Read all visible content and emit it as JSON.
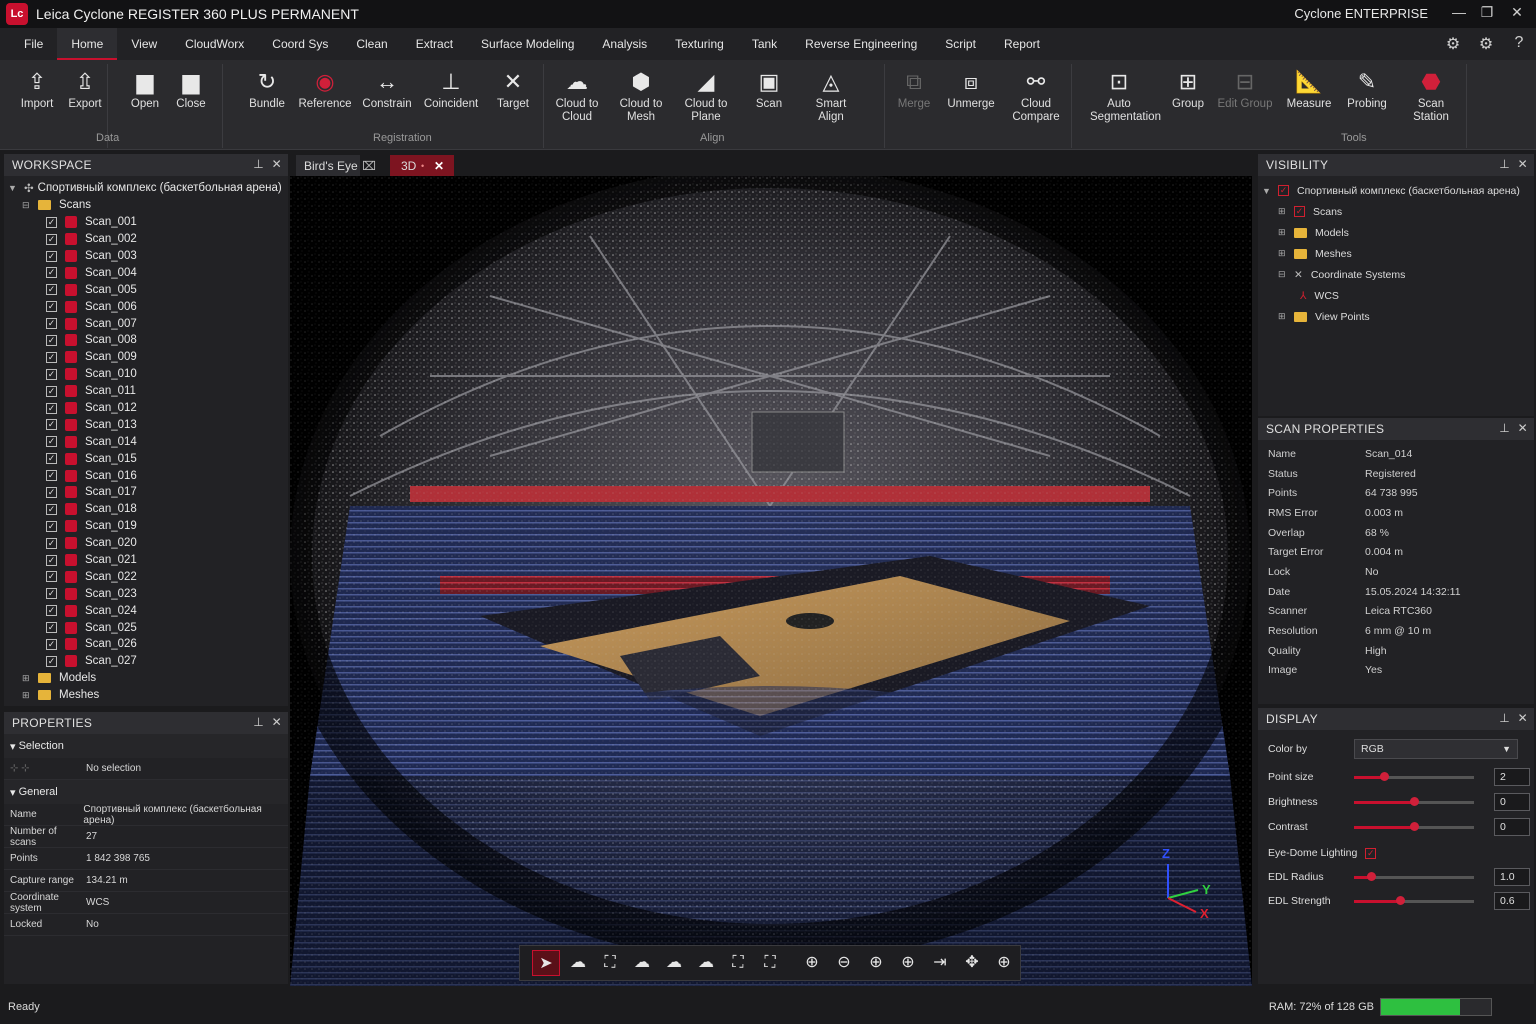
{
  "titlebar": {
    "logo": "Lc",
    "title": "Leica Cyclone REGISTER 360 PLUS PERMANENT",
    "edition": "Cyclone ENTERPRISE",
    "minimize_icon": "minimize-icon",
    "restore_icon": "restore-icon",
    "close_icon": "close-icon"
  },
  "menu": {
    "items": [
      "File",
      "Home",
      "View",
      "CloudWorx",
      "Coord Sys",
      "Clean",
      "Extract",
      "Surface Modeling",
      "Analysis",
      "Texturing",
      "Tank",
      "Reverse Engineering",
      "Script",
      "Report"
    ],
    "active": "Home"
  },
  "ribbon": {
    "buttons": [
      {
        "label": "Import",
        "icon": "import-icon",
        "glyph": "⇪"
      },
      {
        "label": "Export",
        "icon": "export-icon",
        "glyph": "⇫"
      },
      {
        "label": "Open",
        "icon": "folder-open-icon",
        "glyph": "▆"
      },
      {
        "label": "Close",
        "icon": "folder-close-icon",
        "glyph": "▆"
      },
      {
        "label": "Bundle",
        "icon": "bundle-icon",
        "glyph": "↻"
      },
      {
        "label": "Reference",
        "icon": "reference-icon",
        "glyph": "◉"
      },
      {
        "label": "Constrain",
        "icon": "constrain-icon",
        "glyph": "↔"
      },
      {
        "label": "Coincident",
        "icon": "coincident-icon",
        "glyph": "⊥"
      },
      {
        "label": "Target",
        "icon": "target-icon",
        "glyph": "✕"
      },
      {
        "label": "Cloud to Cloud",
        "icon": "cloud-to-cloud-icon",
        "glyph": "☁"
      },
      {
        "label": "Cloud to Mesh",
        "icon": "cloud-to-mesh-icon",
        "glyph": "⬢"
      },
      {
        "label": "Cloud to Plane",
        "icon": "cloud-to-plane-icon",
        "glyph": "◢"
      },
      {
        "label": "Scan",
        "icon": "scan-icon",
        "glyph": "▣"
      },
      {
        "label": "Smart Align",
        "icon": "smart-align-icon",
        "glyph": "◬"
      },
      {
        "label": "Merge",
        "icon": "merge-icon",
        "glyph": "⧉"
      },
      {
        "label": "Unmerge",
        "icon": "unmerge-icon",
        "glyph": "⧈"
      },
      {
        "label": "Cloud Compare",
        "icon": "cloud-compare-icon",
        "glyph": "⚯"
      },
      {
        "label": "Auto Segmentation",
        "icon": "auto-segmentation-icon",
        "glyph": "⊡"
      },
      {
        "label": "Group",
        "icon": "group-icon",
        "glyph": "⊞"
      },
      {
        "label": "Edit Group",
        "icon": "edit-group-icon",
        "glyph": "⊟"
      },
      {
        "label": "Measure",
        "icon": "measure-icon",
        "glyph": "📐"
      },
      {
        "label": "Probing",
        "icon": "probing-icon",
        "glyph": "✎"
      },
      {
        "label": "Scan Station",
        "icon": "scan-station-icon",
        "glyph": "⬣"
      }
    ],
    "groups": [
      "Data",
      "Registration",
      "Align",
      "Tools"
    ]
  },
  "workspace": {
    "title": "WORKSPACE",
    "pin_icon": "pin-icon",
    "close_icon": "close-icon",
    "project": "Спортивный комплекс (баскетбольная арена)",
    "scans_folder": "Scans",
    "scans": [
      "Scan_001",
      "Scan_002",
      "Scan_003",
      "Scan_004",
      "Scan_005",
      "Scan_006",
      "Scan_007",
      "Scan_008",
      "Scan_009",
      "Scan_010",
      "Scan_011",
      "Scan_012",
      "Scan_013",
      "Scan_014",
      "Scan_015",
      "Scan_016",
      "Scan_017",
      "Scan_018",
      "Scan_019",
      "Scan_020",
      "Scan_021",
      "Scan_022",
      "Scan_023",
      "Scan_024",
      "Scan_025",
      "Scan_026",
      "Scan_027"
    ],
    "models_folder": "Models",
    "meshes_folder": "Meshes"
  },
  "properties": {
    "title": "PROPERTIES",
    "selection_header": "Selection",
    "selection_value": "No selection",
    "general_header": "General",
    "rows": [
      {
        "k": "Name",
        "v": "Спортивный комплекс (баскетбольная арена)"
      },
      {
        "k": "Number of scans",
        "v": "27"
      },
      {
        "k": "Points",
        "v": "1 842 398 765"
      },
      {
        "k": "Capture range",
        "v": "134.21 m"
      },
      {
        "k": "Coordinate system",
        "v": "WCS"
      },
      {
        "k": "Locked",
        "v": "No"
      }
    ]
  },
  "tabs": {
    "birds_eye": "Bird's Eye",
    "threed": "3D"
  },
  "viewport": {
    "axis_z": "Z",
    "axis_y": "Y",
    "axis_x": "X",
    "toolbar_icons": [
      "select-icon",
      "cloud-icon",
      "fit-icon",
      "cloud-select-icon",
      "cloud-search-icon",
      "cloud-zoom-icon",
      "frame-icon",
      "expand-icon",
      "zoom-in-icon",
      "zoom-out-icon",
      "zoom-window-icon",
      "zoom-extents-icon",
      "exit-icon",
      "pan-icon",
      "target-crosshair-icon"
    ],
    "toolbar_glyphs": [
      "➤",
      "☁",
      "⛶",
      "☁",
      "☁",
      "☁",
      "⛶",
      "⛶",
      "⊕",
      "⊖",
      "⊕",
      "⊕",
      "⇥",
      "✥",
      "⊕"
    ]
  },
  "visibility": {
    "title": "VISIBILITY",
    "project": "Спортивный комплекс (баскетбольная арена)",
    "items": [
      "Scans",
      "Models",
      "Meshes",
      "Coordinate Systems",
      "WCS",
      "View Points"
    ]
  },
  "scan_properties": {
    "title": "SCAN PROPERTIES",
    "rows": [
      {
        "k": "Name",
        "v": "Scan_014"
      },
      {
        "k": "Status",
        "v": "Registered"
      },
      {
        "k": "Points",
        "v": "64 738 995"
      },
      {
        "k": "RMS Error",
        "v": "0.003 m"
      },
      {
        "k": "Overlap",
        "v": "68 %"
      },
      {
        "k": "Target Error",
        "v": "0.004 m"
      },
      {
        "k": "Lock",
        "v": "No"
      },
      {
        "k": "Date",
        "v": "15.05.2024 14:32:11"
      },
      {
        "k": "Scanner",
        "v": "Leica RTC360"
      },
      {
        "k": "Resolution",
        "v": "6 mm @ 10 m"
      },
      {
        "k": "Quality",
        "v": "High"
      },
      {
        "k": "Image",
        "v": "Yes"
      }
    ]
  },
  "display": {
    "title": "DISPLAY",
    "color_by_label": "Color by",
    "color_by_value": "RGB",
    "point_size_label": "Point size",
    "point_size_value": "2",
    "point_size_level": 0.25,
    "brightness_label": "Brightness",
    "brightness_value": "0",
    "brightness_level": 0.5,
    "contrast_label": "Contrast",
    "contrast_value": "0",
    "contrast_level": 0.5,
    "edl_label": "Eye-Dome Lighting",
    "edl_radius_label": "EDL Radius",
    "edl_radius_value": "1.0",
    "edl_radius_level": 0.14,
    "edl_strength_label": "EDL Strength",
    "edl_strength_value": "0.6",
    "edl_strength_level": 0.38
  },
  "status": {
    "text": "Ready",
    "ram": "RAM: 72% of 128 GB",
    "ram_level": 0.72
  },
  "colors": {
    "accent": "#c8102e",
    "ram_bar": "#2ec040",
    "panel": "#222225"
  }
}
